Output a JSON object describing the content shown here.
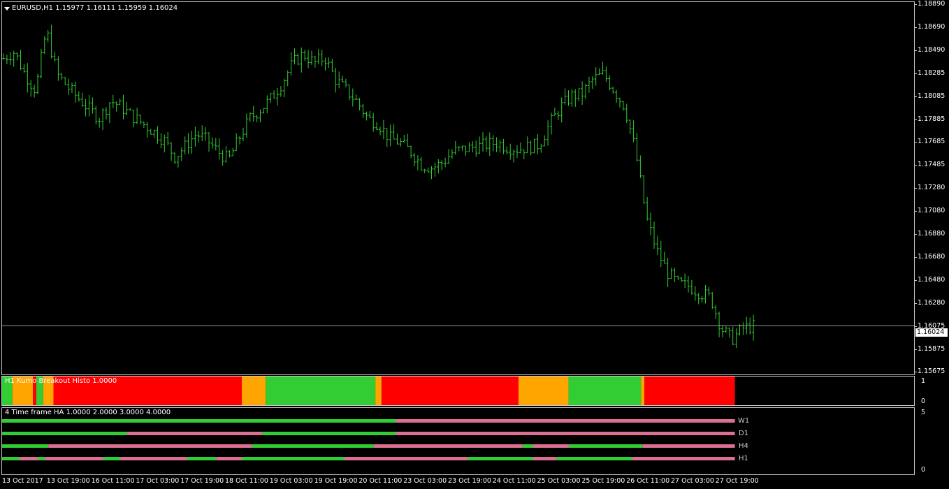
{
  "chart": {
    "title": "EURUSD,H1  1.15977 1.16111 1.15959 1.16024",
    "current_price": "1.16024",
    "bar_color": "#32cd32",
    "background": "#000000",
    "grid_color": "#c8c8c8"
  },
  "price_axis": [
    "1.18890",
    "1.18690",
    "1.18490",
    "1.18285",
    "1.18085",
    "1.17885",
    "1.17685",
    "1.17485",
    "1.17280",
    "1.17080",
    "1.16880",
    "1.16680",
    "1.16480",
    "1.16280",
    "1.16075",
    "1.15875",
    "1.15675"
  ],
  "time_axis": [
    "13 Oct 2017",
    "13 Oct 19:00",
    "16 Oct 11:00",
    "17 Oct 03:00",
    "17 Oct 19:00",
    "18 Oct 11:00",
    "19 Oct 03:00",
    "19 Oct 19:00",
    "20 Oct 11:00",
    "23 Oct 03:00",
    "23 Oct 19:00",
    "24 Oct 11:00",
    "25 Oct 03:00",
    "25 Oct 19:00",
    "26 Oct 11:00",
    "27 Oct 03:00",
    "27 Oct 19:00"
  ],
  "chart_data": {
    "type": "ohlc",
    "symbol": "EURUSD",
    "timeframe": "H1",
    "ylim": [
      1.1557,
      1.1895
    ],
    "close_path": [
      1.1844,
      1.185,
      1.183,
      1.1815,
      1.187,
      1.183,
      1.1818,
      1.1808,
      1.1798,
      1.179,
      1.1806,
      1.18,
      1.1792,
      1.1785,
      1.1778,
      1.177,
      1.1755,
      1.1765,
      1.1776,
      1.177,
      1.176,
      1.1752,
      1.1772,
      1.179,
      1.1798,
      1.1808,
      1.1822,
      1.184,
      1.1848,
      1.184,
      1.1845,
      1.1825,
      1.1815,
      1.1805,
      1.179,
      1.1785,
      1.1772,
      1.1768,
      1.176,
      1.1748,
      1.1745,
      1.175,
      1.176,
      1.1762,
      1.1764,
      1.1766,
      1.1768,
      1.1764,
      1.1762,
      1.1764,
      1.1766,
      1.1785,
      1.18,
      1.181,
      1.1812,
      1.1825,
      1.183,
      1.1815,
      1.18,
      1.176,
      1.17,
      1.167,
      1.165,
      1.164,
      1.1638,
      1.1632,
      1.1628,
      1.16,
      1.159,
      1.16,
      1.1602
    ],
    "n_bars": 220
  },
  "histo": {
    "label": "H1 Kumo Breakout Histo 1.0000",
    "scale_top": "1",
    "scale_bottom": "0",
    "segments": [
      {
        "from": 0,
        "to": 3,
        "color": "#32cd32"
      },
      {
        "from": 3,
        "to": 9,
        "color": "#ffa500"
      },
      {
        "from": 9,
        "to": 10,
        "color": "#ff0000"
      },
      {
        "from": 10,
        "to": 12,
        "color": "#32cd32"
      },
      {
        "from": 12,
        "to": 15,
        "color": "#ffa500"
      },
      {
        "from": 15,
        "to": 70,
        "color": "#ff0000"
      },
      {
        "from": 70,
        "to": 77,
        "color": "#ffa500"
      },
      {
        "from": 77,
        "to": 109,
        "color": "#32cd32"
      },
      {
        "from": 109,
        "to": 110.8,
        "color": "#ffa500"
      },
      {
        "from": 110.8,
        "to": 150.8,
        "color": "#ff0000"
      },
      {
        "from": 150.8,
        "to": 165.4,
        "color": "#ffa500"
      },
      {
        "from": 165.4,
        "to": 186.6,
        "color": "#32cd32"
      },
      {
        "from": 186.6,
        "to": 187.6,
        "color": "#ffa500"
      },
      {
        "from": 187.6,
        "to": 214,
        "color": "#ff0000"
      }
    ]
  },
  "tf": {
    "label": "4 Time frame HA 1.0000 2.0000 3.0000 4.0000",
    "scale_top": "5",
    "scale_bottom": "0",
    "rows": [
      {
        "name": "W1",
        "segments": [
          {
            "from": 0,
            "to": 115,
            "color": "#32cd32"
          },
          {
            "from": 115,
            "to": 214,
            "color": "#db7093"
          }
        ]
      },
      {
        "name": "D1",
        "segments": [
          {
            "from": 0,
            "to": 36.5,
            "color": "#32cd32"
          },
          {
            "from": 36.5,
            "to": 76,
            "color": "#db7093"
          },
          {
            "from": 76,
            "to": 115,
            "color": "#32cd32"
          },
          {
            "from": 115,
            "to": 214,
            "color": "#db7093"
          }
        ]
      },
      {
        "name": "H4",
        "segments": [
          {
            "from": 0,
            "to": 13.5,
            "color": "#32cd32"
          },
          {
            "from": 13.5,
            "to": 73,
            "color": "#db7093"
          },
          {
            "from": 73,
            "to": 108.5,
            "color": "#32cd32"
          },
          {
            "from": 108.5,
            "to": 152,
            "color": "#db7093"
          },
          {
            "from": 152,
            "to": 155,
            "color": "#32cd32"
          },
          {
            "from": 155,
            "to": 165.5,
            "color": "#db7093"
          },
          {
            "from": 165.5,
            "to": 187,
            "color": "#32cd32"
          },
          {
            "from": 187,
            "to": 214,
            "color": "#db7093"
          }
        ]
      },
      {
        "name": "H1",
        "segments": [
          {
            "from": 0,
            "to": 5,
            "color": "#32cd32"
          },
          {
            "from": 5,
            "to": 10.5,
            "color": "#db7093"
          },
          {
            "from": 10.5,
            "to": 12.5,
            "color": "#32cd32"
          },
          {
            "from": 12.5,
            "to": 29.5,
            "color": "#db7093"
          },
          {
            "from": 29.5,
            "to": 34.5,
            "color": "#32cd32"
          },
          {
            "from": 34.5,
            "to": 54,
            "color": "#db7093"
          },
          {
            "from": 54,
            "to": 62.5,
            "color": "#32cd32"
          },
          {
            "from": 62.5,
            "to": 70,
            "color": "#db7093"
          },
          {
            "from": 70,
            "to": 100,
            "color": "#32cd32"
          },
          {
            "from": 100,
            "to": 136,
            "color": "#db7093"
          },
          {
            "from": 136,
            "to": 155,
            "color": "#32cd32"
          },
          {
            "from": 155,
            "to": 162,
            "color": "#db7093"
          },
          {
            "from": 162,
            "to": 184,
            "color": "#32cd32"
          },
          {
            "from": 184,
            "to": 214,
            "color": "#db7093"
          }
        ]
      }
    ]
  }
}
